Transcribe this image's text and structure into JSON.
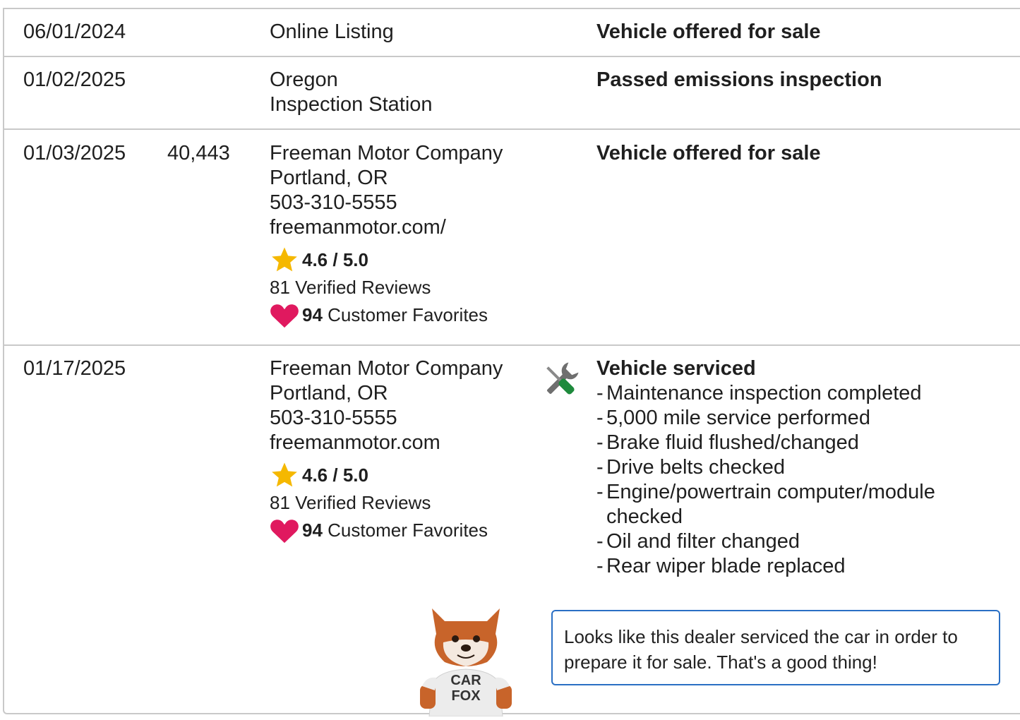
{
  "records": [
    {
      "date": "06/01/2024",
      "mileage": "",
      "source": [
        "Online Listing"
      ],
      "comment_title": "Vehicle offered for sale"
    },
    {
      "date": "01/02/2025",
      "mileage": "",
      "source": [
        "Oregon",
        "Inspection Station"
      ],
      "comment_title": "Passed emissions inspection"
    },
    {
      "date": "01/03/2025",
      "mileage": "40,443",
      "source": [
        "Freeman Motor Company",
        "Portland, OR",
        "503-310-5555",
        "freemanmotor.com/"
      ],
      "rating": "4.6 / 5.0",
      "reviews": "81 Verified Reviews",
      "favorites_count": "94",
      "favorites_label": "Customer Favorites",
      "comment_title": "Vehicle offered for sale"
    },
    {
      "date": "01/17/2025",
      "mileage": "",
      "source": [
        "Freeman Motor Company",
        "Portland, OR",
        "503-310-5555",
        "freemanmotor.com"
      ],
      "rating": "4.6 / 5.0",
      "reviews": "81 Verified Reviews",
      "favorites_count": "94",
      "favorites_label": "Customer Favorites",
      "comment_title": "Vehicle serviced",
      "service_icon": "tools-icon",
      "service_items": [
        "Maintenance inspection completed",
        "5,000 mile service performed",
        "Brake fluid flushed/changed",
        "Drive belts checked",
        "Engine/powertrain computer/module checked",
        "Oil and filter changed",
        "Rear wiper blade replaced"
      ]
    }
  ],
  "mascot": {
    "shirt_line1": "CAR",
    "shirt_line2": "FOX"
  },
  "tip": "Looks like this dealer serviced the car in order to prepare it for sale. That's a good thing!",
  "colors": {
    "border": "#c9c9c9",
    "star": "#f5b800",
    "heart": "#e0195f",
    "tip_border": "#2a6fc4",
    "wrench_green": "#1e8a3c"
  }
}
